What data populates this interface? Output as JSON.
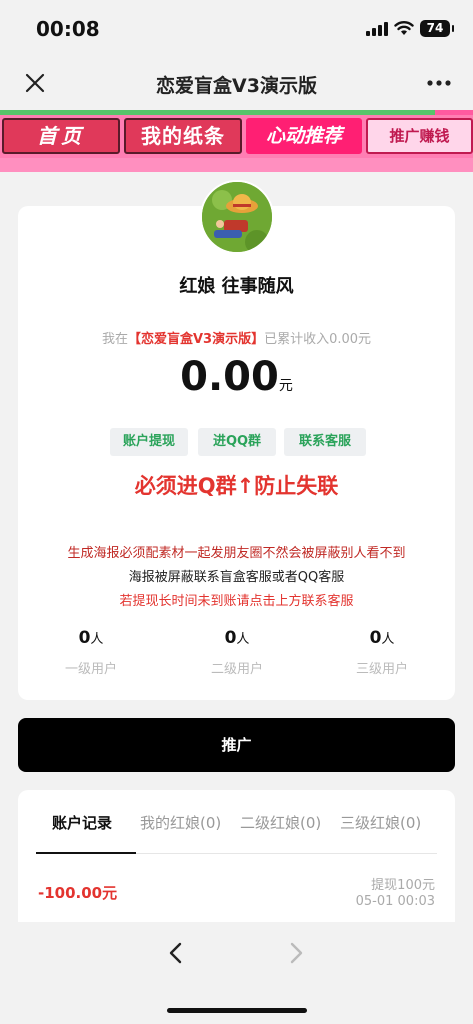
{
  "status_bar": {
    "time": "00:08",
    "battery": "74"
  },
  "nav": {
    "title": "恋爱盲盒V3演示版"
  },
  "banner": {
    "tabs": [
      "首页",
      "我的纸条",
      "心动推荐",
      "推广赚钱"
    ]
  },
  "profile": {
    "name": "红娘 往事随风",
    "income_prefix": "我在",
    "income_app": "【恋爱盲盒V3演示版】",
    "income_suffix": "已累计收入0.00元",
    "balance": "0.00",
    "balance_unit": "元"
  },
  "actions": [
    "账户提现",
    "进QQ群",
    "联系客服"
  ],
  "warning": "必须进Q群↑防止失联",
  "notice": {
    "line1": "生成海报必须配素材一起发朋友圈不然会被屏蔽别人看不到",
    "line2": "海报被屏蔽联系盲盒客服或者QQ客服",
    "line3": "若提现长时间未到账请点击上方联系客服"
  },
  "levels": [
    {
      "count": "0",
      "unit": "人",
      "label": "一级用户"
    },
    {
      "count": "0",
      "unit": "人",
      "label": "二级用户"
    },
    {
      "count": "0",
      "unit": "人",
      "label": "三级用户"
    }
  ],
  "promote_button": "推广",
  "record_tabs": [
    "账户记录",
    "我的红娘(0)",
    "二级红娘(0)",
    "三级红娘(0)"
  ],
  "records": [
    {
      "amount": "-100.00元",
      "desc": "提现100元",
      "time": "05-01 00:03"
    }
  ],
  "icons": {
    "close": "close-icon",
    "more": "more-icon",
    "back": "chevron-left-icon",
    "forward": "chevron-right-icon"
  },
  "colors": {
    "accent_red": "#e3342f",
    "action_green": "#2aa35a",
    "banner_pink": "#ff7eb3",
    "primary_button": "#000000"
  }
}
